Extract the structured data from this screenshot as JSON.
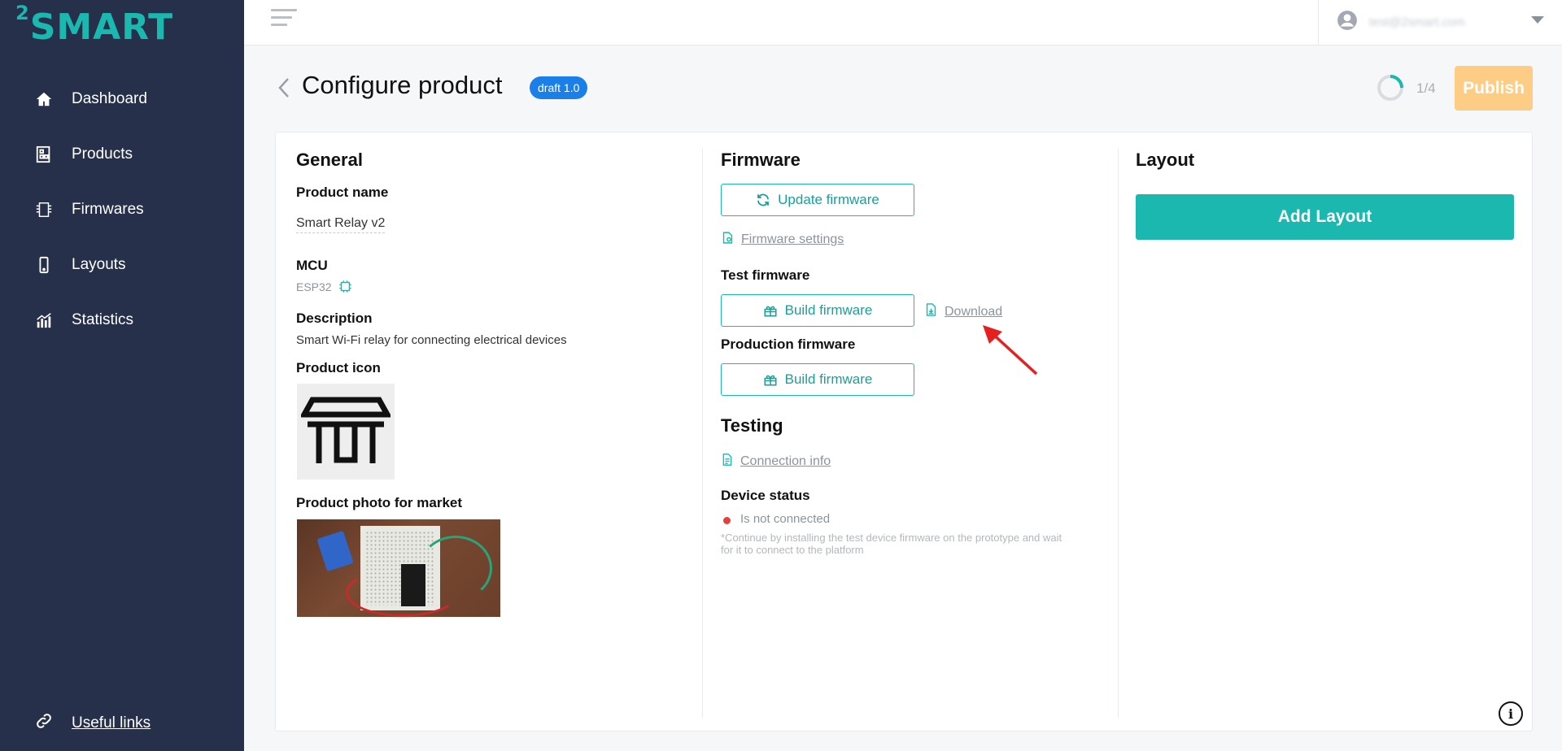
{
  "brand": {
    "logo_text": "SMART",
    "logo_sup": "2",
    "accent": "#1bb8b0",
    "sidebar_bg": "#26304a"
  },
  "sidebar": {
    "items": [
      {
        "label": "Dashboard",
        "icon": "home-icon"
      },
      {
        "label": "Products",
        "icon": "products-icon"
      },
      {
        "label": "Firmwares",
        "icon": "chip-icon"
      },
      {
        "label": "Layouts",
        "icon": "phone-icon"
      },
      {
        "label": "Statistics",
        "icon": "chart-icon"
      }
    ],
    "useful_links": "Useful links"
  },
  "topbar": {
    "user_email": "test@2smart.com"
  },
  "header": {
    "title": "Configure product",
    "badge": "draft 1.0",
    "progress_text": "1/4",
    "progress": 0.25,
    "publish_label": "Publish"
  },
  "general": {
    "title": "General",
    "product_name_label": "Product name",
    "product_name": "Smart Relay v2",
    "mcu_label": "MCU",
    "mcu_value": "ESP32",
    "description_label": "Description",
    "description": "Smart Wi-Fi relay for connecting electrical devices",
    "icon_label": "Product icon",
    "photo_label": "Product photo for market"
  },
  "firmware": {
    "title": "Firmware",
    "update_label": "Update firmware",
    "settings_link": "Firmware settings",
    "test_label": "Test firmware",
    "build_label": "Build firmware",
    "download_link": "Download",
    "production_label": "Production firmware",
    "build_label_2": "Build firmware"
  },
  "testing": {
    "title": "Testing",
    "connection_link": "Connection info",
    "device_status_label": "Device status",
    "status_text": "Is not connected",
    "hint": "*Continue by installing the test device firmware on the prototype and wait for it to connect to the platform"
  },
  "layout": {
    "title": "Layout",
    "add_label": "Add Layout"
  }
}
